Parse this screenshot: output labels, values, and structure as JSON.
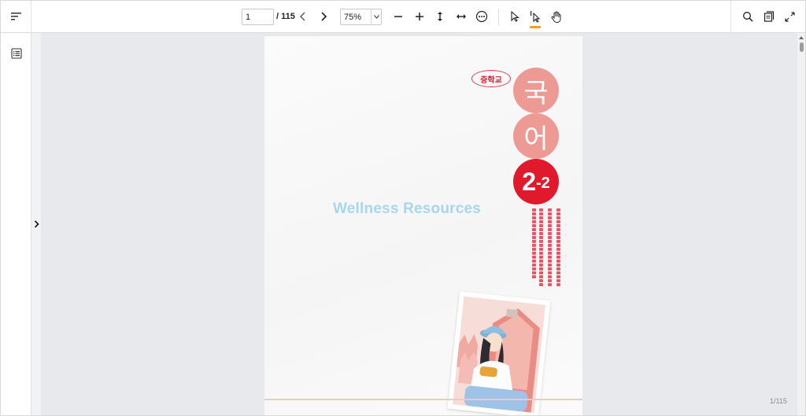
{
  "toolbar": {
    "page_current": "1",
    "page_total": "/ 115",
    "zoom_value": "75%",
    "icons": {
      "menu": "sort-lines-icon",
      "prev_page": "chevron-left-icon",
      "next_page": "chevron-right-icon",
      "zoom_out": "minus-icon",
      "zoom_in": "plus-icon",
      "fit_height": "vertical-arrows-icon",
      "fit_width": "horizontal-arrows-icon",
      "more": "more-horizontal-icon",
      "select": "cursor-arrow-icon",
      "text_select": "text-cursor-icon",
      "pan": "hand-icon",
      "search": "search-icon",
      "copy_doc": "copy-document-icon",
      "fullscreen": "expand-icon"
    },
    "active_tool_color": "#f0a020"
  },
  "sidebar": {
    "icon": "list-icon",
    "expand_icon": "chevron-right-icon"
  },
  "document": {
    "watermark": "Wellness Resources",
    "badge": "중학교",
    "title_char_1": "국",
    "title_char_2": "어",
    "grade_big": "2",
    "grade_small": "-2",
    "accent_color": "#e0192d",
    "soft_accent_color": "#ee9a94"
  },
  "status": {
    "page_counter": "1/115"
  }
}
